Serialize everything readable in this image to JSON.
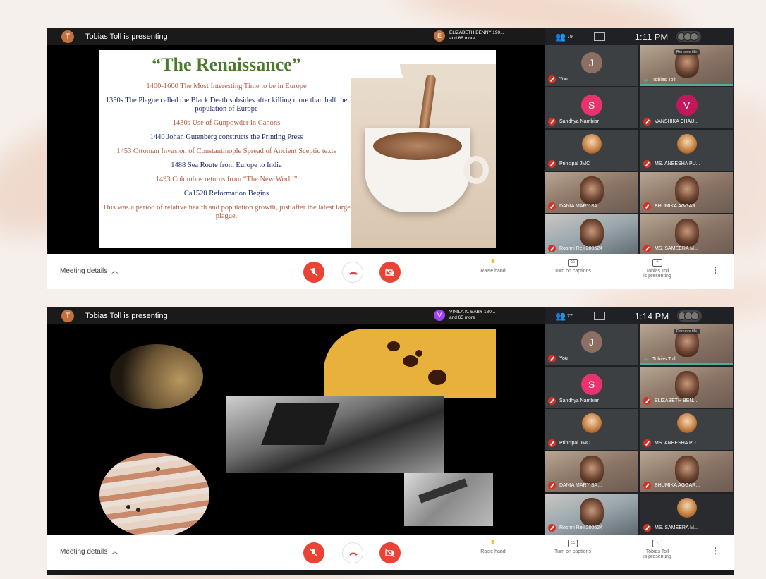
{
  "screens": [
    {
      "presenter": {
        "initial": "T",
        "text": "Tobias Toll is presenting"
      },
      "viewers": {
        "initial": "E",
        "color": "#c2703d",
        "line1": "ELIZABETH BENNY 190...",
        "line2": "and 66 more"
      },
      "sidebar": {
        "people_count": "79",
        "time": "1:11 PM"
      },
      "tiles": [
        {
          "type": "letter",
          "initial": "J",
          "color": "#8d6e63",
          "name": "You"
        },
        {
          "type": "cam",
          "name": "Tobias Toll",
          "remove": "Remove tile",
          "speaking": true
        },
        {
          "type": "letter",
          "initial": "S",
          "color": "#e8336e",
          "name": "Sandhya Nambiar"
        },
        {
          "type": "letter",
          "initial": "V",
          "color": "#c2185b",
          "name": "VANSHIKA CHAU..."
        },
        {
          "type": "photo",
          "name": "Principal JMC"
        },
        {
          "type": "photo",
          "name": "MS. ANEESHA PU..."
        },
        {
          "type": "cam",
          "name": "DANIA MARY SA..."
        },
        {
          "type": "cam",
          "name": "BHUMIKA AGGAR..."
        },
        {
          "type": "cam2",
          "name": "Roshni Reji 200624"
        },
        {
          "type": "cam",
          "name": "MS. SAMEERA M..."
        }
      ]
    },
    {
      "presenter": {
        "initial": "T",
        "text": "Tobias Toll is presenting"
      },
      "viewers": {
        "initial": "V",
        "color": "#a142f4",
        "line1": "VINILA K. BABY 180...",
        "line2": "and 65 more"
      },
      "sidebar": {
        "people_count": "77",
        "time": "1:14 PM"
      },
      "tiles": [
        {
          "type": "letter",
          "initial": "J",
          "color": "#8d6e63",
          "name": "You"
        },
        {
          "type": "cam",
          "name": "Tobias Toll",
          "remove": "Remove tile",
          "speaking": true
        },
        {
          "type": "letter",
          "initial": "S",
          "color": "#e8336e",
          "name": "Sandhya Nambiar"
        },
        {
          "type": "cam",
          "name": "ELIZABETH BEN..."
        },
        {
          "type": "photo",
          "name": "Principal JMC"
        },
        {
          "type": "photo",
          "name": "MS. ANEESHA PU..."
        },
        {
          "type": "cam",
          "name": "DANIA MARY SA..."
        },
        {
          "type": "cam",
          "name": "BHUMIKA AGGAR..."
        },
        {
          "type": "cam2",
          "name": "Roshni Reji 200624"
        },
        {
          "type": "dark",
          "name": "MS. SAMEERA M..."
        }
      ]
    }
  ],
  "controls": {
    "meeting_details": "Meeting details",
    "raise_hand": "Raise hand",
    "captions": "Turn on captions",
    "presenting_line1": "Tobias Toll",
    "presenting_line2": "is presenting"
  },
  "slide1": {
    "title": "“The Renaissance”",
    "lines": [
      {
        "text": "1400-1600 The Most Interesting Time to be in Europe",
        "color": "red"
      },
      {
        "text": "1350s The Plague called the Black Death subsides after killing more than half the population of Europe",
        "color": "navy"
      },
      {
        "text": "1430s Use of Gunpowder in Canons",
        "color": "red"
      },
      {
        "text": "1440 Johan Gutenberg constructs the Printing Press",
        "color": "navy"
      },
      {
        "text": "1453 Ottoman Invasion of Constantinople Spread of Ancient Sceptic texts",
        "color": "red"
      },
      {
        "text": "1488 Sea Route from Europe to India",
        "color": "navy"
      },
      {
        "text": "1493 Columbus returns from “The New World”",
        "color": "red"
      },
      {
        "text": "Ca1520 Reformation Begins",
        "color": "navy"
      },
      {
        "text": "This was a period of relative health and population growth, just after the latest large plague.",
        "color": "red"
      }
    ]
  }
}
